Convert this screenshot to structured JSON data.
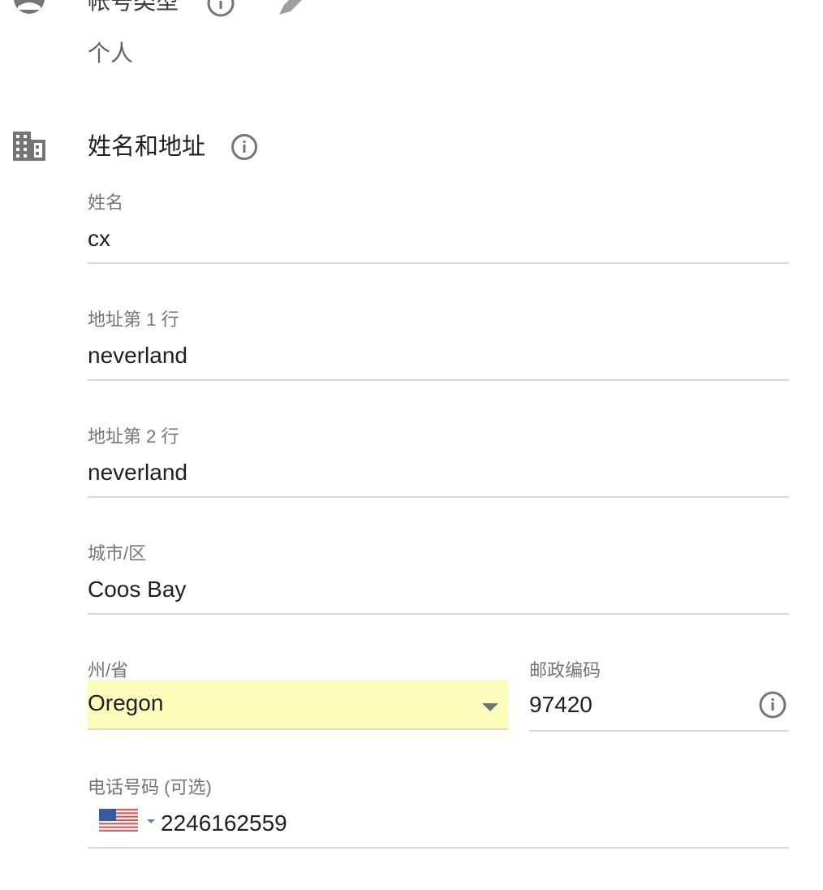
{
  "account_type": {
    "title": "帐号类型",
    "value": "个人",
    "icon": "person-icon",
    "info_icon": "info-icon",
    "edit_icon": "edit-pencil-icon"
  },
  "name_address": {
    "title": "姓名和地址",
    "icon": "building-icon",
    "info_icon": "info-icon",
    "fields": {
      "name": {
        "label": "姓名",
        "value": "cx"
      },
      "address1": {
        "label": "地址第 1 行",
        "value": "neverland"
      },
      "address2": {
        "label": "地址第 2 行",
        "value": "neverland"
      },
      "city": {
        "label": "城市/区",
        "value": "Coos Bay"
      },
      "state": {
        "label": "州/省",
        "value": "Oregon",
        "highlight_color": "#fcfcbc"
      },
      "zip": {
        "label": "邮政编码",
        "value": "97420"
      },
      "phone": {
        "label": "电话号码 (可选)",
        "value": "2246162559",
        "country_flag": "us-flag-icon"
      }
    }
  },
  "colors": {
    "icon_gray": "#757575",
    "divider": "#d9d9d9",
    "autofill_yellow": "#fcfcbc"
  }
}
